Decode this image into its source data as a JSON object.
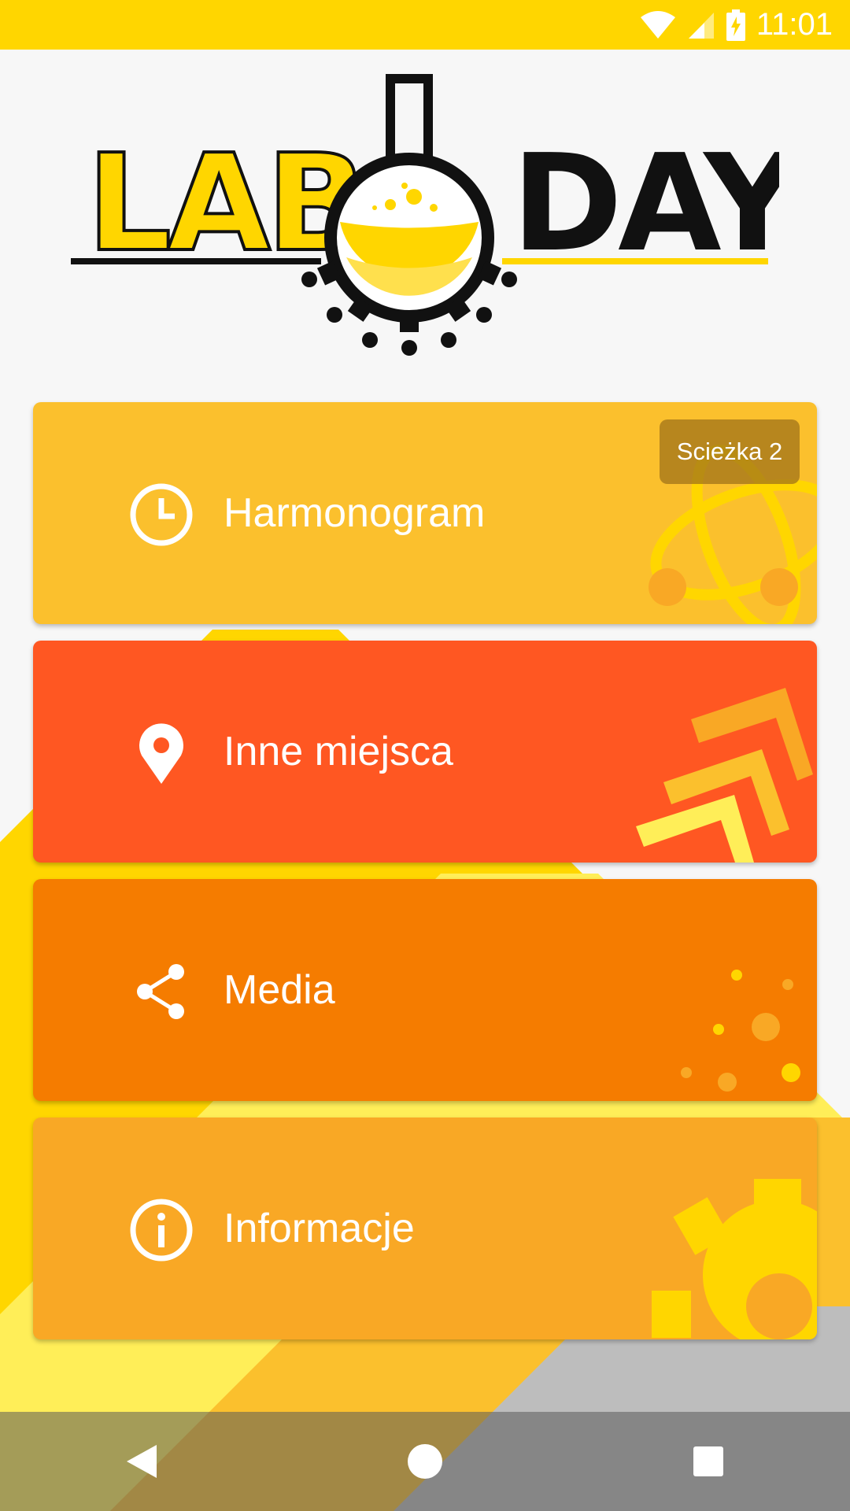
{
  "status_bar": {
    "time": "11:01",
    "icons": [
      "wifi-icon",
      "signal-icon",
      "battery-charging-icon"
    ],
    "color": "#FFD600"
  },
  "logo": {
    "left_text": "LAB",
    "right_text": "DAY"
  },
  "menu": {
    "items": [
      {
        "label": "Harmonogram",
        "icon": "clock-icon",
        "color": "#FBC02D",
        "badge": "Scieżka 2"
      },
      {
        "label": "Inne miejsca",
        "icon": "location-pin-icon",
        "color": "#FF5722"
      },
      {
        "label": "Media",
        "icon": "share-icon",
        "color": "#F57C00"
      },
      {
        "label": "Informacje",
        "icon": "info-icon",
        "color": "#F9A825"
      }
    ]
  },
  "nav_bar": {
    "buttons": [
      "back-icon",
      "home-icon",
      "recents-icon"
    ]
  }
}
